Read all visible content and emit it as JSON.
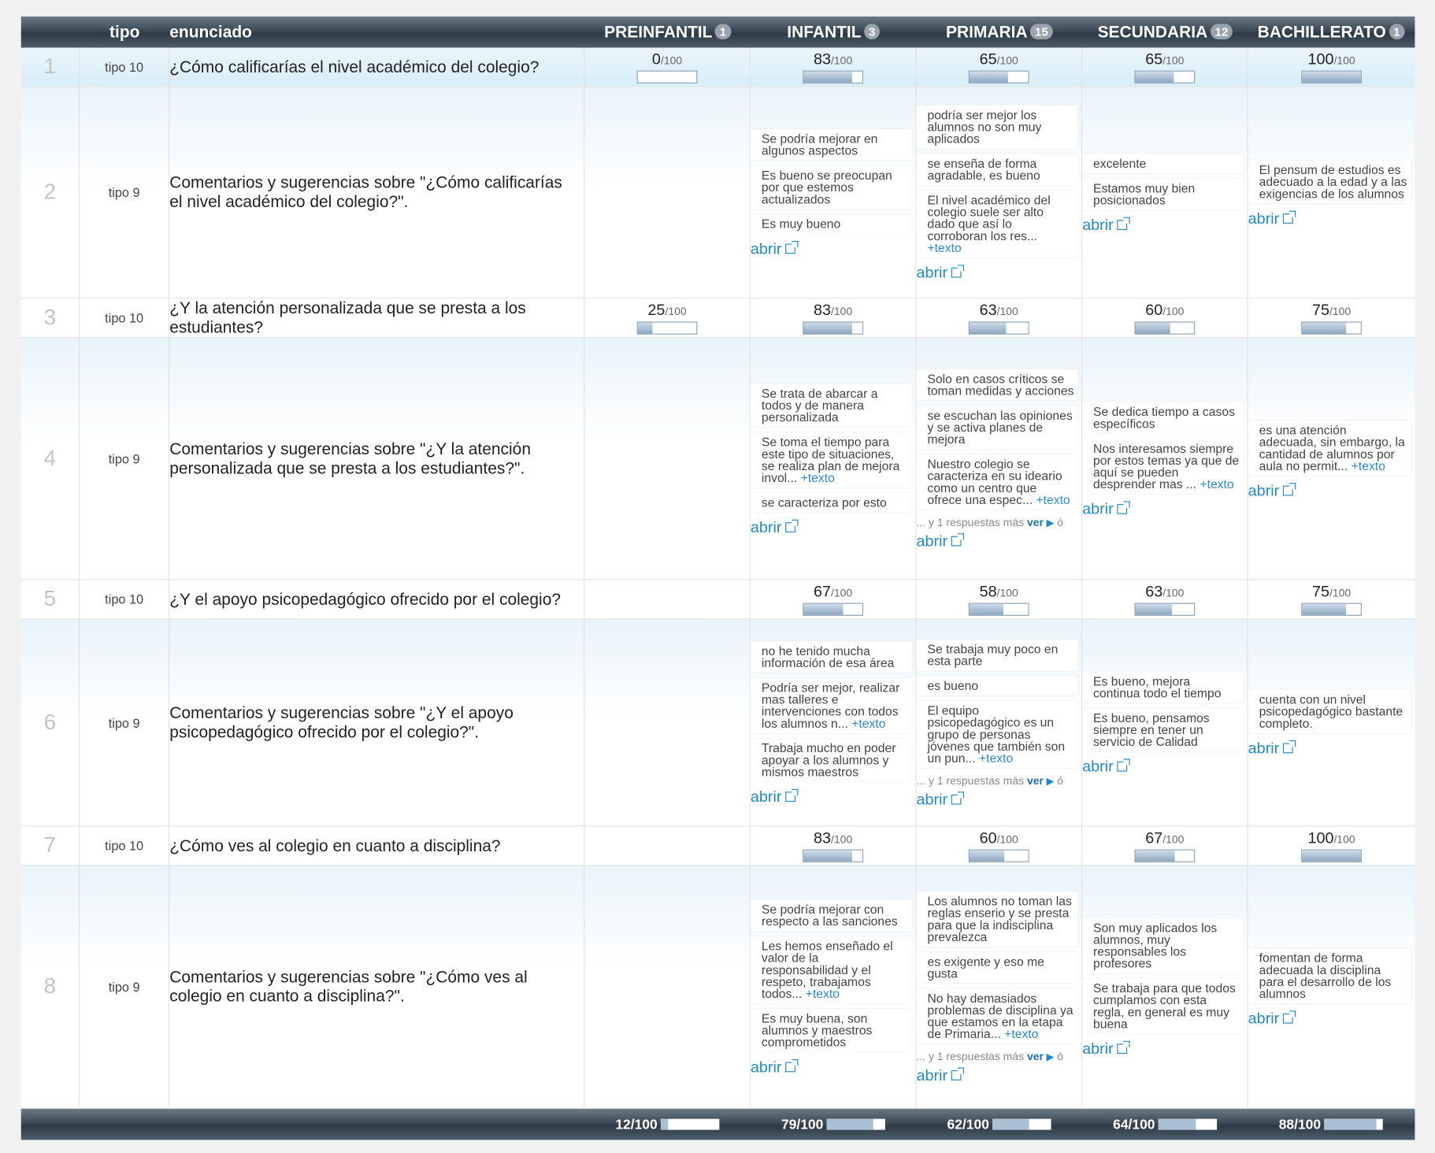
{
  "header": {
    "tipo": "tipo",
    "enunciado": "enunciado",
    "levels": [
      {
        "name": "PREINFANTIL",
        "count": "1"
      },
      {
        "name": "INFANTIL",
        "count": "3"
      },
      {
        "name": "PRIMARIA",
        "count": "15"
      },
      {
        "name": "SECUNDARIA",
        "count": "12"
      },
      {
        "name": "BACHILLERATO",
        "count": "1"
      }
    ]
  },
  "rows": [
    {
      "num": "1",
      "tipo": "tipo 10",
      "enunciado": "¿Cómo calificarías el nivel académico del colegio?",
      "scores": [
        {
          "value": "0",
          "of": "/100",
          "fill": 0
        },
        {
          "value": "83",
          "of": "/100",
          "fill": 0.83
        },
        {
          "value": "65",
          "of": "/100",
          "fill": 0.65
        },
        {
          "value": "65",
          "of": "/100",
          "fill": 0.65
        },
        {
          "value": "100",
          "of": "/100",
          "fill": 1.0
        }
      ]
    },
    {
      "num": "2",
      "tipo": "tipo 9",
      "enunciado": "Comentarios y sugerencias sobre \"¿Cómo calificarías el nivel académico del colegio?\".",
      "comments": [
        null,
        {
          "items": [
            {
              "text": "Se podría mejorar en algunos aspectos"
            },
            {
              "text": "Es bueno se preocupan por que estemos actualizados"
            },
            {
              "text": "Es muy bueno"
            }
          ],
          "abrir": "abrir"
        },
        {
          "items": [
            {
              "text": "podría ser mejor los alumnos no son muy aplicados"
            },
            {
              "text": "se enseña de forma agradable, es bueno"
            },
            {
              "text": "El nivel académico del colegio suele ser alto dado que así lo corroboran los res...",
              "more": "+texto"
            }
          ],
          "abrir": "abrir"
        },
        {
          "items": [
            {
              "text": "excelente"
            },
            {
              "text": "Estamos muy bien posicionados"
            }
          ],
          "abrir": "abrir"
        },
        {
          "items": [
            {
              "text": "El pensum de estudios es adecuado a la edad y a las exigencias de los alumnos"
            }
          ],
          "abrir": "abrir"
        }
      ]
    },
    {
      "num": "3",
      "tipo": "tipo 10",
      "enunciado": "¿Y la atención personalizada que se presta a los estudiantes?",
      "scores": [
        {
          "value": "25",
          "of": "/100",
          "fill": 0.25
        },
        {
          "value": "83",
          "of": "/100",
          "fill": 0.83
        },
        {
          "value": "63",
          "of": "/100",
          "fill": 0.63
        },
        {
          "value": "60",
          "of": "/100",
          "fill": 0.6
        },
        {
          "value": "75",
          "of": "/100",
          "fill": 0.75
        }
      ]
    },
    {
      "num": "4",
      "tipo": "tipo 9",
      "enunciado": "Comentarios y sugerencias sobre \"¿Y la atención personalizada que se presta a los estudiantes?\".",
      "comments": [
        null,
        {
          "items": [
            {
              "text": "Se trata de abarcar a todos y de manera personalizada"
            },
            {
              "text": "Se toma el tiempo para este tipo de situaciones, se realiza plan de mejora invol...",
              "more": "+texto"
            },
            {
              "text": "se caracteriza por esto"
            }
          ],
          "abrir": "abrir"
        },
        {
          "items": [
            {
              "text": "Solo en casos críticos se toman medidas y acciones"
            },
            {
              "text": "se escuchan las opiniones y se activa planes de mejora"
            },
            {
              "text": "Nuestro colegio se caracteriza en su ideario como un centro que ofrece una espec...",
              "more": "+texto"
            }
          ],
          "ymas": {
            "pre": "... y 1 respuestas más ",
            "ver": "ver",
            "post": " ó"
          },
          "abrir": "abrir"
        },
        {
          "items": [
            {
              "text": "Se dedica tiempo a casos específicos"
            },
            {
              "text": "Nos interesamos siempre por estos temas ya que de aquí se pueden desprender mas ...",
              "more": "+texto"
            }
          ],
          "abrir": "abrir"
        },
        {
          "items": [
            {
              "text": "es una atención adecuada, sin embargo, la cantidad de alumnos por aula no permit...",
              "more": "+texto"
            }
          ],
          "abrir": "abrir"
        }
      ]
    },
    {
      "num": "5",
      "tipo": "tipo 10",
      "enunciado": "¿Y el apoyo psicopedagógico ofrecido por el colegio?",
      "scores": [
        null,
        {
          "value": "67",
          "of": "/100",
          "fill": 0.67
        },
        {
          "value": "58",
          "of": "/100",
          "fill": 0.58
        },
        {
          "value": "63",
          "of": "/100",
          "fill": 0.63
        },
        {
          "value": "75",
          "of": "/100",
          "fill": 0.75
        }
      ]
    },
    {
      "num": "6",
      "tipo": "tipo 9",
      "enunciado": "Comentarios y sugerencias sobre \"¿Y el apoyo psicopedagógico ofrecido por el colegio?\".",
      "comments": [
        null,
        {
          "items": [
            {
              "text": "no he tenido mucha información de esa área"
            },
            {
              "text": "Podría ser mejor, realizar mas talleres e intervenciones con todos los alumnos n...",
              "more": "+texto"
            },
            {
              "text": "Trabaja mucho en poder apoyar a los alumnos y mismos maestros"
            }
          ],
          "abrir": "abrir"
        },
        {
          "items": [
            {
              "text": "Se trabaja muy poco en esta parte"
            },
            {
              "text": "es bueno"
            },
            {
              "text": "El equipo psicopedagógico es un grupo de personas jóvenes que también son un pun...",
              "more": "+texto"
            }
          ],
          "ymas": {
            "pre": "... y 1 respuestas más ",
            "ver": "ver",
            "post": " ó"
          },
          "abrir": "abrir"
        },
        {
          "items": [
            {
              "text": "Es bueno, mejora continua todo el tiempo"
            },
            {
              "text": "Es bueno, pensamos siempre en tener un servicio de Calidad"
            }
          ],
          "abrir": "abrir"
        },
        {
          "items": [
            {
              "text": "cuenta con un nivel psicopedagógico bastante completo."
            }
          ],
          "abrir": "abrir"
        }
      ]
    },
    {
      "num": "7",
      "tipo": "tipo 10",
      "enunciado": "¿Cómo ves al colegio en cuanto a disciplina?",
      "scores": [
        null,
        {
          "value": "83",
          "of": "/100",
          "fill": 0.83
        },
        {
          "value": "60",
          "of": "/100",
          "fill": 0.6
        },
        {
          "value": "67",
          "of": "/100",
          "fill": 0.67
        },
        {
          "value": "100",
          "of": "/100",
          "fill": 1.0
        }
      ]
    },
    {
      "num": "8",
      "tipo": "tipo 9",
      "enunciado": "Comentarios y sugerencias sobre \"¿Cómo ves al colegio en cuanto a disciplina?\".",
      "comments": [
        null,
        {
          "items": [
            {
              "text": "Se podría mejorar con respecto a las sanciones"
            },
            {
              "text": "Les hemos enseñado el valor de la responsabilidad y el respeto, trabajamos todos...",
              "more": "+texto"
            },
            {
              "text": "Es muy buena, son alumnos y maestros comprometidos"
            }
          ],
          "abrir": "abrir"
        },
        {
          "items": [
            {
              "text": "Los alumnos no toman las reglas enserio y se presta para que la indisciplina prevalezca"
            },
            {
              "text": "es exigente y eso me gusta"
            },
            {
              "text": "No hay demasiados problemas de disciplina ya que estamos en la etapa de Primaria...",
              "more": "+texto"
            }
          ],
          "ymas": {
            "pre": "... y 1 respuestas más ",
            "ver": "ver",
            "post": " ó"
          },
          "abrir": "abrir"
        },
        {
          "items": [
            {
              "text": "Son muy aplicados los alumnos, muy responsables los profesores"
            },
            {
              "text": "Se trabaja para que todos cumplamos con esta regla, en general es muy buena"
            }
          ],
          "abrir": "abrir"
        },
        {
          "items": [
            {
              "text": "fomentan de forma adecuada la disciplina para el desarrollo de los alumnos"
            }
          ],
          "abrir": "abrir"
        }
      ]
    }
  ],
  "footer": [
    {
      "value": "12/100",
      "fill": 0.12
    },
    {
      "value": "79/100",
      "fill": 0.79
    },
    {
      "value": "62/100",
      "fill": 0.62
    },
    {
      "value": "64/100",
      "fill": 0.64
    },
    {
      "value": "88/100",
      "fill": 0.88
    }
  ],
  "colors": {
    "link": "#1f8acb",
    "header_dark": "#3c4a56",
    "bar_fill": "#8ea9c1"
  },
  "icons": {
    "abrir": "external-link-icon",
    "ver": "play-triangle-icon"
  }
}
